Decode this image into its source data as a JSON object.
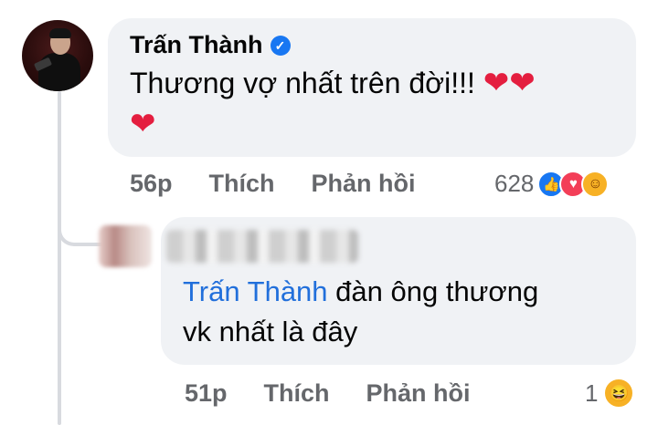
{
  "comment": {
    "author": "Trấn Thành",
    "text": "Thương vợ nhất trên đời!!!",
    "emoji_hearts": "❤️❤️❤️",
    "time": "56p",
    "like_label": "Thích",
    "reply_label": "Phản hồi",
    "reaction_count": "628",
    "reactions": [
      "like-icon",
      "love-icon",
      "care-icon"
    ]
  },
  "reply": {
    "author": "[blurred]",
    "mention": "Trấn Thành",
    "text_line1": " đàn ông thương",
    "text_line2": "vk nhất là đây",
    "time": "51p",
    "like_label": "Thích",
    "reply_label": "Phản hồi",
    "reaction_count": "1",
    "reactions": [
      "haha-icon"
    ]
  },
  "colors": {
    "bubble": "#f0f2f5",
    "action_text": "#65676b",
    "mention": "#216fdb",
    "verified": "#1877f2",
    "heart": "#e41e3f"
  }
}
